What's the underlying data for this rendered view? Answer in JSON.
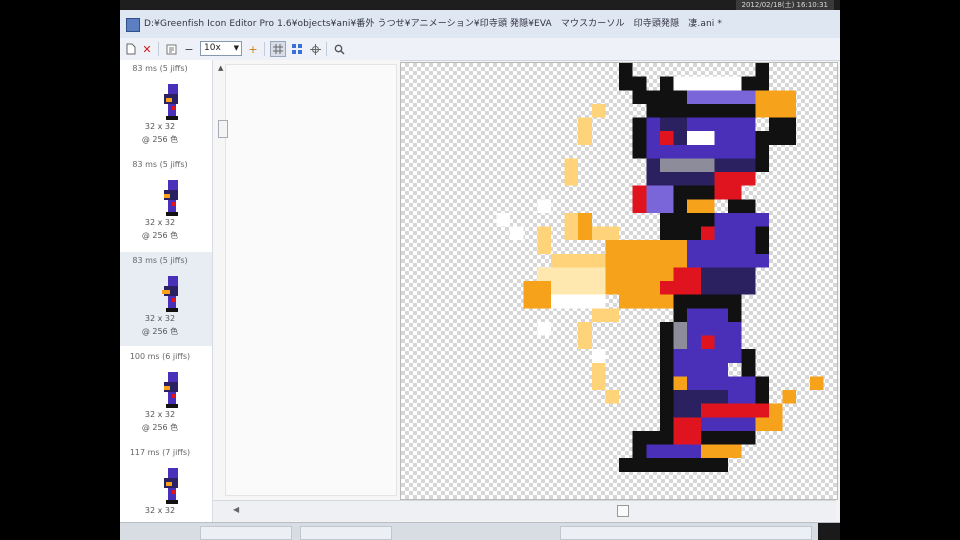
{
  "taskbar": {
    "clock": "2012/02/18(土) 16:10:31"
  },
  "window": {
    "title": "D:¥Greenfish Icon Editor Pro 1.6¥objects¥ani¥番外 うつせ¥アニメーション¥印寺頭 発隠¥EVA　マウスカーソル　印寺頭発隠　凄.ani *"
  },
  "toolbar": {
    "zoom_value": "10x",
    "buttons": [
      "new",
      "delete",
      "properties",
      "zoom-out",
      "zoom-select",
      "zoom-in",
      "grid",
      "tile",
      "center",
      "search"
    ]
  },
  "frames": [
    {
      "delay": "83 ms (5 jiffs)",
      "size": "32 x 32",
      "colors": "@ 256 色",
      "selected": false
    },
    {
      "delay": "83 ms (5 jiffs)",
      "size": "32 x 32",
      "colors": "@ 256 色",
      "selected": false
    },
    {
      "delay": "83 ms (5 jiffs)",
      "size": "32 x 32",
      "colors": "@ 256 色",
      "selected": true
    },
    {
      "delay": "100 ms (6 jiffs)",
      "size": "32 x 32",
      "colors": "@ 256 色",
      "selected": false
    },
    {
      "delay": "117 ms (7 jiffs)",
      "size": "32 x 32",
      "colors": "",
      "selected": false
    }
  ],
  "colors": {
    "purple": "#4a2fb8",
    "purple_light": "#7a66d8",
    "dark": "#111111",
    "red": "#e0141e",
    "orange": "#f6a21a",
    "orange_light": "#ffd37a",
    "white": "#ffffff",
    "gray": "#8c8c9a"
  }
}
